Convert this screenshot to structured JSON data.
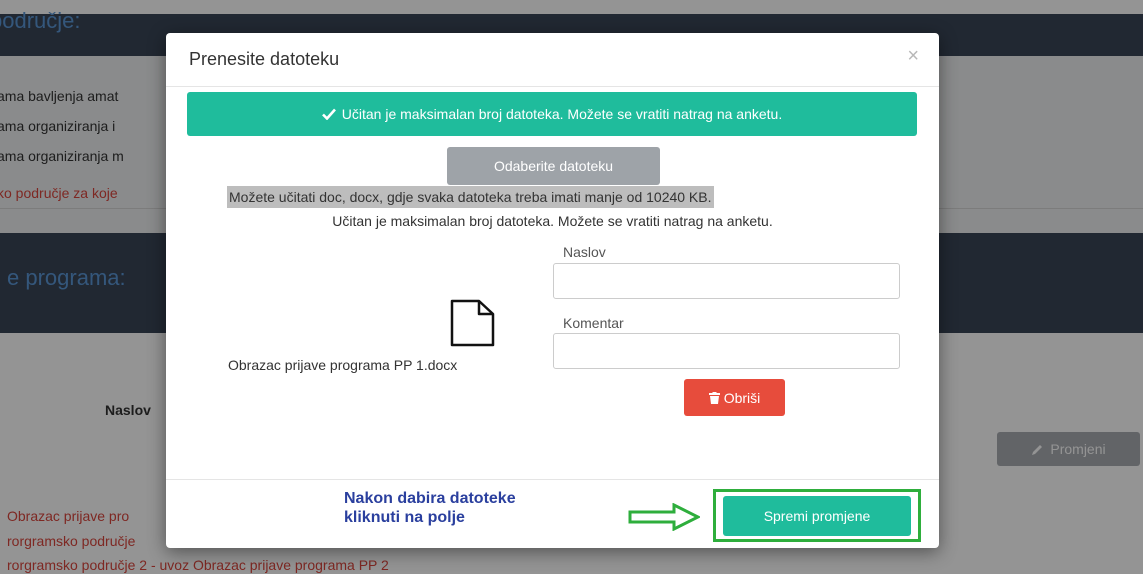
{
  "background": {
    "heading_top": "područje:",
    "heading_mid": "e programa:",
    "lines": [
      "ama bavljenja amat",
      "ama organiziranja i",
      "ama organiziranja m"
    ],
    "red_note": "ko područje za koje",
    "naslov_label": "Naslov",
    "change_button": "Promjeni",
    "list_items": [
      "Obrazac prijave pro",
      "rorgramsko područje",
      "rorgramsko područje 2 - uvoz Obrazac prijave programa PP 2"
    ]
  },
  "modal": {
    "title": "Prenesite datoteku",
    "close_symbol": "×",
    "success_message": "Učitan je maksimalan broj datoteka. Možete se vratiti natrag na anketu.",
    "select_button": "Odaberite datoteku",
    "hint": "Možete učitati doc, docx, gdje svaka datoteka treba imati manje od 10240 KB.",
    "max_message": "Učitan je maksimalan broj datoteka. Možete se vratiti natrag na anketu.",
    "file_name": "Obrazac prijave programa PP 1.docx",
    "title_label": "Naslov",
    "comment_label": "Komentar",
    "delete_button": "Obriši",
    "instruction_line1": "Nakon dabira datoteke",
    "instruction_line2": "kliknuti na polje",
    "save_button": "Spremi promjene"
  },
  "colors": {
    "success": "#1fbc9c",
    "danger": "#e74c3c",
    "highlight": "#2eae3c",
    "instruction": "#2a3f9e"
  }
}
